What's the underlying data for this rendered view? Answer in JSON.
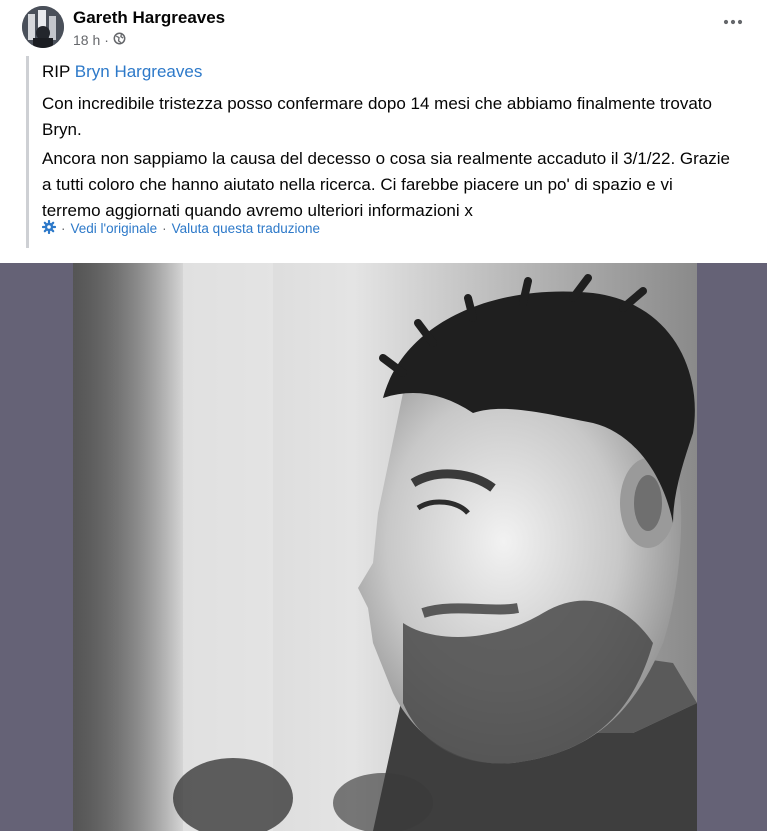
{
  "post": {
    "author": "Gareth Hargreaves",
    "timestamp": "18 h",
    "separator": "·",
    "audience_icon": "globe-icon",
    "more_icon": "more-dots-icon",
    "prefix": "RIP ",
    "tagged": "Bryn Hargreaves",
    "paragraph1_line1": "Con incredibile tristezza posso confermare dopo 14 mesi che abbiamo finalmente trovato",
    "paragraph1_line2": "Bryn.",
    "paragraph2_line1": "Ancora non sappiamo la causa del decesso o cosa sia realmente accaduto il 3/1/22. Grazie",
    "paragraph2_line2": "a tutti coloro che hanno aiutato nella ricerca. Ci farebbe piacere un po' di spazio e vi",
    "paragraph2_line3": "terremo aggiornati quando avremo ulteriori informazioni x"
  },
  "translation": {
    "icon": "gear-icon",
    "sep": "·",
    "see_original": "Vedi l'originale",
    "rate": "Valuta questa traduzione"
  },
  "colors": {
    "link": "#2d79c9",
    "meta": "#65676b",
    "quote_bar": "#ced0d4",
    "media_bg": "#656276"
  }
}
